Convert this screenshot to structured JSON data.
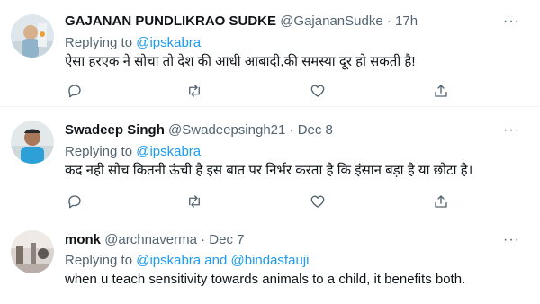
{
  "tweets": [
    {
      "name": "GAJANAN PUNDLIKRAO SUDKE",
      "handle": "@GajananSudke",
      "time": "· 17h",
      "replying_label": "Replying to",
      "replying_to": "@ipskabra",
      "text": "ऐसा हरएक  ने सोचा तो देश की आधी आबादी,की समस्या दूर हो सकती है!",
      "more_icon": "more-icon"
    },
    {
      "name": "Swadeep Singh",
      "handle": "@Swadeepsingh21",
      "time": "· Dec 8",
      "replying_label": "Replying to",
      "replying_to": "@ipskabra",
      "text": "कद नही सोच कितनी ऊंची है इस बात पर निर्भर करता है कि इंसान बड़ा है या छोटा है।",
      "more_icon": "more-icon"
    },
    {
      "name": "monk",
      "handle": "@archnaverma",
      "time": "· Dec 7",
      "replying_label": "Replying to",
      "replying_to": "@ipskabra and @bindasfauji",
      "text": "when u teach sensitivity towards animals to a child, it benefits both.",
      "more_icon": "more-icon"
    }
  ],
  "more_glyph": "···",
  "icons": [
    "reply-icon",
    "retweet-icon",
    "like-icon",
    "share-icon"
  ],
  "colors": {
    "text": "#0f1419",
    "secondary": "#536471",
    "accent": "#1d9bf0",
    "divider": "#eff3f4"
  }
}
